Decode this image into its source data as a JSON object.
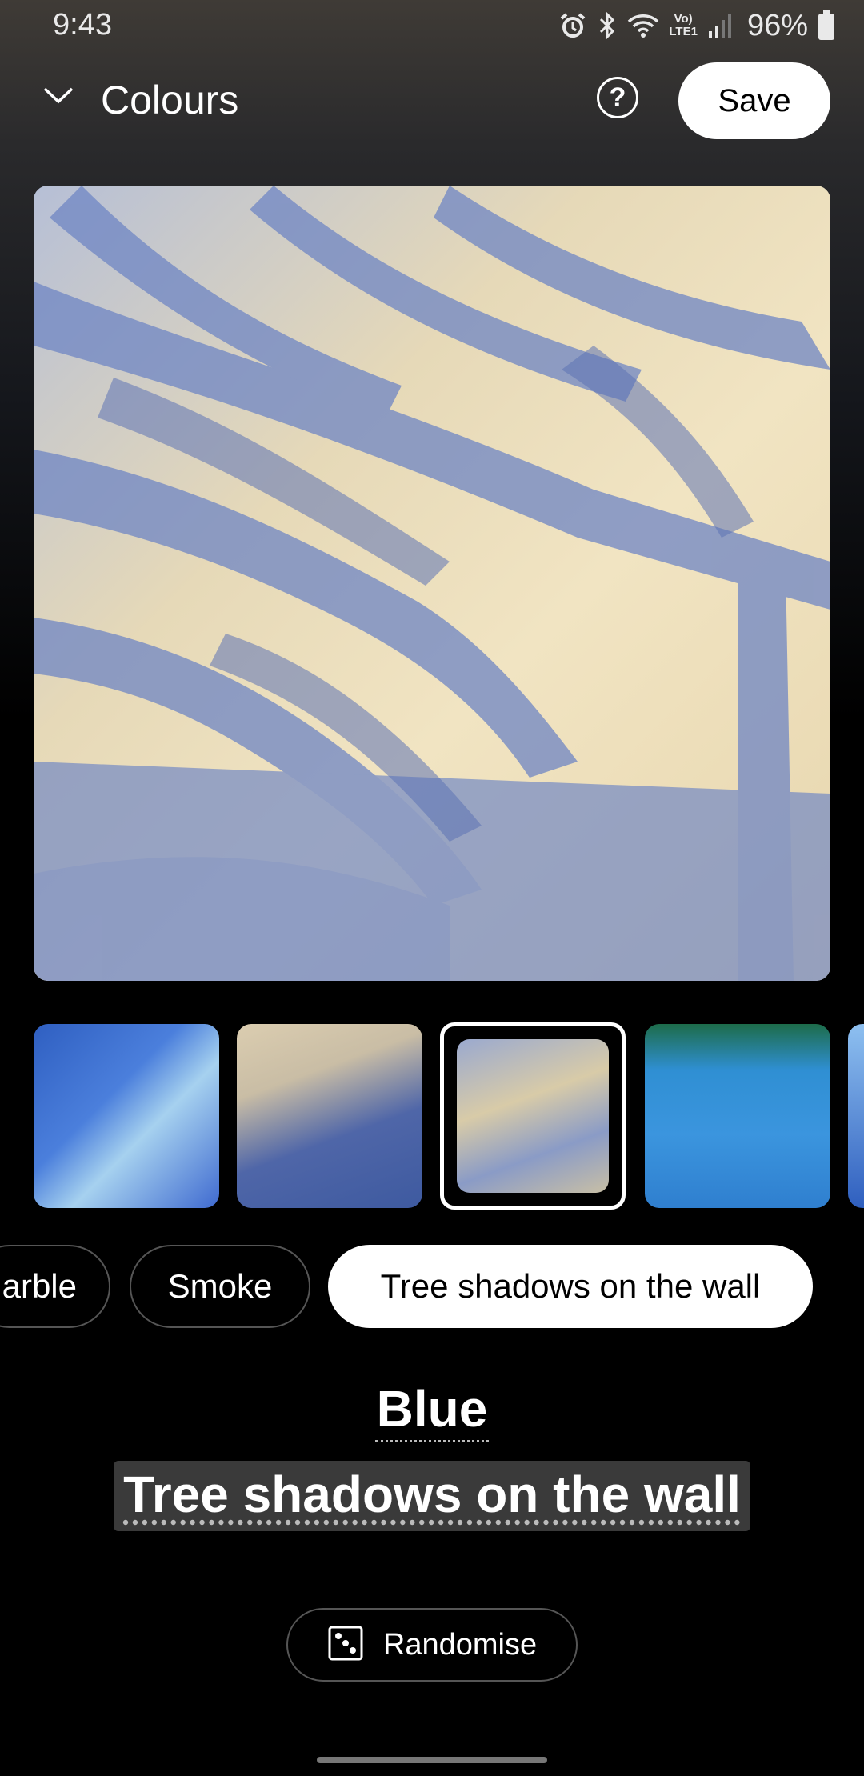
{
  "status_bar": {
    "time": "9:43",
    "volte_line1": "Vo)",
    "volte_line2": "LTE1",
    "battery_percent": "96%",
    "icons": [
      "alarm-icon",
      "bluetooth-icon",
      "wifi-icon",
      "volte-icon",
      "signal-icon",
      "battery-icon"
    ]
  },
  "header": {
    "title": "Colours",
    "help_icon": "?",
    "save_label": "Save"
  },
  "thumbnails": [
    {
      "id": "thumb-1",
      "selected": false
    },
    {
      "id": "thumb-2",
      "selected": false
    },
    {
      "id": "thumb-3",
      "selected": true
    },
    {
      "id": "thumb-4",
      "selected": false
    },
    {
      "id": "thumb-5",
      "selected": false
    }
  ],
  "chips": [
    {
      "label": "arble",
      "selected": false
    },
    {
      "label": "Smoke",
      "selected": false
    },
    {
      "label": "Tree shadows on the wall",
      "selected": true
    }
  ],
  "name": {
    "color": "Blue",
    "style": "Tree shadows on the wall"
  },
  "randomise": {
    "label": "Randomise"
  },
  "colors": {
    "background": "#000000",
    "accent": "#ffffff"
  }
}
